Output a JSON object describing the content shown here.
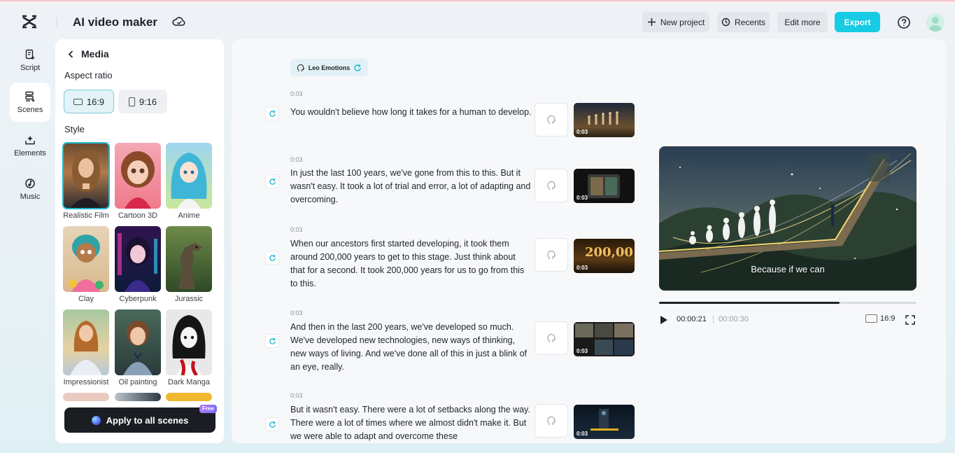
{
  "header": {
    "app_title": "AI video maker",
    "new_project": "New project",
    "recents": "Recents",
    "edit_more": "Edit more",
    "export": "Export"
  },
  "rail": {
    "items": [
      {
        "label": "Script",
        "icon": "script-icon"
      },
      {
        "label": "Scenes",
        "icon": "scenes-icon",
        "active": true
      },
      {
        "label": "Elements",
        "icon": "elements-icon"
      },
      {
        "label": "Music",
        "icon": "music-icon"
      }
    ]
  },
  "panel": {
    "title": "Media",
    "aspect_label": "Aspect ratio",
    "aspect_options": [
      "16:9",
      "9:16"
    ],
    "aspect_selected": "16:9",
    "style_label": "Style",
    "styles": [
      "Realistic Film",
      "Cartoon 3D",
      "Anime",
      "Clay",
      "Cyberpunk",
      "Jurassic",
      "Impressionist",
      "Oil painting",
      "Dark Manga"
    ],
    "style_selected": "Realistic Film",
    "apply_button": "Apply to all scenes",
    "free_badge": "Free"
  },
  "script": {
    "voice_name": "Leo Emotions",
    "scenes": [
      {
        "time": "0:03",
        "text": "You wouldn't believe how long it takes for a human to develop.",
        "thumb_duration": "0:03"
      },
      {
        "time": "0:03",
        "text": "In just the last 100 years, we've gone from this to this. But it wasn't easy. It took a lot of trial and error, a lot of adapting and overcoming.",
        "thumb_duration": "0:03"
      },
      {
        "time": "0:03",
        "text": "When our ancestors first started developing, it took them around 200,000 years to get to this stage. Just think about that for a second. It took 200,000 years for us to go from this to this.",
        "thumb_duration": "0:03",
        "thumb_text": "200,00"
      },
      {
        "time": "0:03",
        "text": "And then in the last 200 years, we've developed so much. We've developed new technologies, new ways of thinking, new ways of living. And we've done all of this in just a blink of an eye, really.",
        "thumb_duration": "0:03"
      },
      {
        "time": "0:03",
        "text": "But it wasn't easy. There were a lot of setbacks along the way. There were a lot of times where we almost didn't make it. But we were able to adapt and overcome these",
        "thumb_duration": "0:03"
      }
    ]
  },
  "preview": {
    "caption": "Because if we can",
    "current_time": "00:00:21",
    "total_time": "00:00:30",
    "progress": 0.7,
    "ratio": "16:9"
  },
  "colors": {
    "accent": "#16cbe3",
    "dark": "#1a1d22"
  }
}
